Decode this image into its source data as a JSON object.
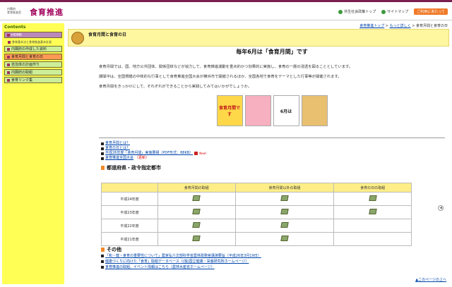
{
  "header": {
    "org_line1": "内閣府",
    "org_line2": "食育推進室",
    "site_title": "食育推進",
    "links": [
      {
        "label": "共生社会政策トップ"
      },
      {
        "label": "サイトマップ"
      }
    ],
    "help_label": "ご利用にあたって"
  },
  "sidebar": {
    "title": "Contents",
    "home_label": "HOME",
    "sub_label": "食育基本法と食育推進基本計画",
    "items": [
      {
        "label": "内閣府の作成した資料"
      },
      {
        "label": "食育月間と食育の日"
      },
      {
        "label": "自治体の計画作り"
      },
      {
        "label": "内閣府の取組"
      },
      {
        "label": "食育リンク集"
      }
    ]
  },
  "breadcrumb": {
    "items": [
      "食育推進トップ",
      "もっと詳しく",
      "食育月間と食育の日"
    ],
    "separator": " > "
  },
  "page_header": {
    "title": "食育月間と食育の日"
  },
  "main": {
    "heading": "毎年6月は「食育月間」です",
    "paragraphs": [
      "食育月間では、国、地方公共団体、関係団体などが協力して、食育推進運動を重点的かつ効果的に実施し、食育の一層の浸透を図ることとしています。",
      "期間中は、全国規模の中核的な行事として食育推進全国大会が横浜市で開催されるほか、全国各地で食育をテーマとした行事等が開催されます。",
      "食育月間をきっかけにして、それぞれができることから実践してみてはいかがでしょうか。"
    ],
    "posters": [
      {
        "text": "食育月間です"
      },
      {
        "text": ""
      },
      {
        "text": "6月は"
      },
      {
        "text": ""
      }
    ]
  },
  "links": [
    {
      "label": "食育月間とは？"
    },
    {
      "label": "食育の日とは？"
    },
    {
      "label": "平成26年度「食育月間」実施要綱（PDF形式：88KB）",
      "pdf": true,
      "new": "New!"
    },
    {
      "label": "食育推進全国大会",
      "suffix": "（更新）"
    }
  ],
  "table_section": {
    "title": "都道府県・政令指定都市",
    "columns": [
      "",
      "食育月間の取組",
      "食育月間以外の取組",
      "食育の日の取組"
    ],
    "rows": [
      {
        "label": "平成24年度",
        "cells": [
          true,
          true,
          true
        ]
      },
      {
        "label": "平成23年度",
        "cells": [
          true,
          true,
          true
        ]
      },
      {
        "label": "平成22年度",
        "cells": [
          true,
          true,
          false
        ]
      },
      {
        "label": "平成21年度",
        "cells": [
          true,
          true,
          false
        ]
      }
    ]
  },
  "other_section": {
    "title": "その他",
    "links": [
      {
        "label": "「和・健・食育の重要性について」農家弘介文部科学省農林政務官講演要旨（平成26年3月19日）"
      },
      {
        "label": "健康づくりに向けた「食育」取組データベース（(独)国立健康・栄養研究所ホームページ）"
      },
      {
        "label": "食育推進の取組、イベント情報はこちら（農林水産省ホームページ）"
      }
    ]
  },
  "page_top_label": "▲このページの上へ",
  "colors": {
    "brand": "#a0005a",
    "sidebar_bg": "#ffff55",
    "active_item": "#ff9955",
    "header_band": "#fff6a0"
  }
}
